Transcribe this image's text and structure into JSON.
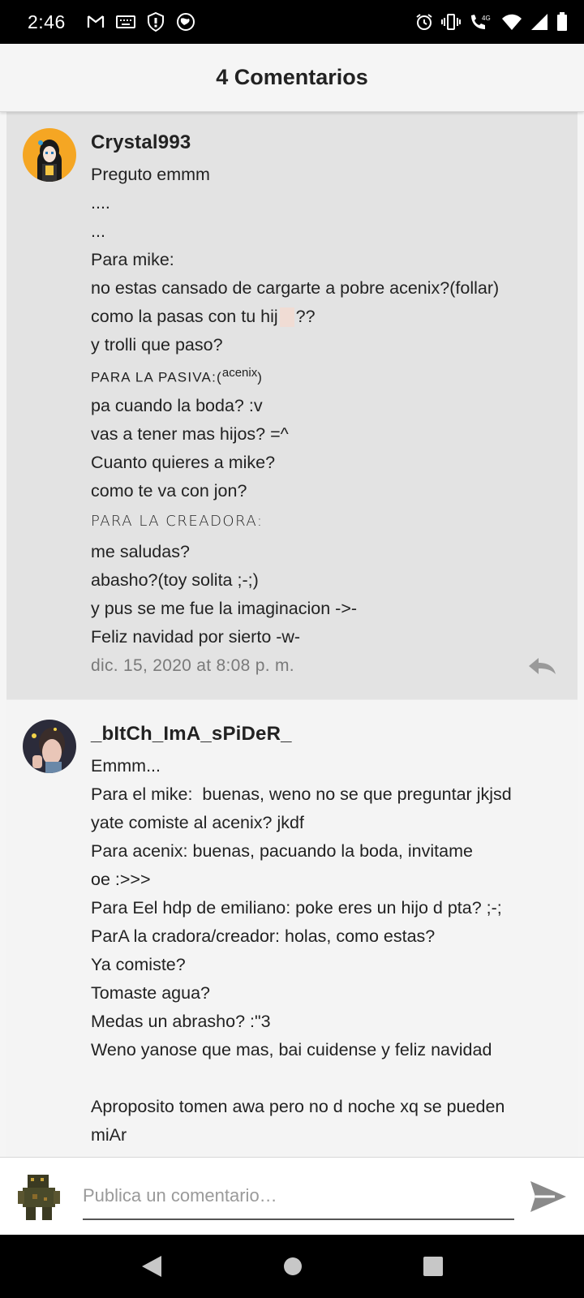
{
  "status_bar": {
    "time": "2:46",
    "network": "4G",
    "icons": [
      "gmail-icon",
      "keyboard-icon",
      "shield-icon",
      "vpn-globe-icon",
      "alarm-icon",
      "vibrate-icon",
      "volte-call-icon",
      "wifi-icon",
      "signal-icon",
      "battery-icon"
    ]
  },
  "header": {
    "title": "4 Comentarios"
  },
  "comments": [
    {
      "username": "Crystal993",
      "avatar_icon": "anime-girl-avatar",
      "lines": [
        "Preguto emmm",
        "....",
        "...",
        "Para mike:",
        "no estas cansado de cargarte a pobre acenix?(follar)",
        "como la pasas con tu hij",
        "??",
        "y trolli que paso?",
        "PARA LA PASIVA:(",
        "acenix",
        ")",
        "pa cuando la boda? :v",
        "vas a tener mas hijos? =^",
        "Cuanto quieres a mike?",
        "como te va con jon?",
        "PARA LA CREADORA:",
        "me saludas?",
        "abasho?(toy solita ;-;)",
        "y pus se me fue la imaginacion ->-",
        "Feliz navidad por sierto -w-"
      ],
      "timestamp": "dic. 15, 2020 at 8:08 p. m."
    },
    {
      "username": "_bItCh_ImA_sPiDeR_",
      "avatar_icon": "photo-avatar",
      "lines": [
        "Emmm...",
        "Para el mike:  buenas, weno no se que preguntar jkjsd",
        "yate comiste al acenix? jkdf",
        "Para acenix: buenas, pacuando la boda, invitame",
        "oe :>>>",
        "Para Eel hdp de emiliano: poke eres un hijo d pta? ;-;",
        "ParA la cradora/creador: holas, como estas?",
        "Ya comiste?",
        "Tomaste agua?",
        "Medas un abrasho? :\"3",
        "Weno yanose que mas, bai cuidense y feliz navidad",
        "",
        "Aproposito tomen awa pero no d noche xq se pueden",
        "miAr"
      ]
    }
  ],
  "composer": {
    "placeholder": "Publica un comentario…",
    "avatar_icon": "pixel-character-avatar",
    "send_icon": "send-icon"
  },
  "nav_bar": {
    "icons": [
      "back-icon",
      "home-icon",
      "recents-icon"
    ]
  },
  "colors": {
    "accent": "#f5a623",
    "highlight_bg": "#e3e3e3",
    "timestamp": "#7a7a7a"
  }
}
